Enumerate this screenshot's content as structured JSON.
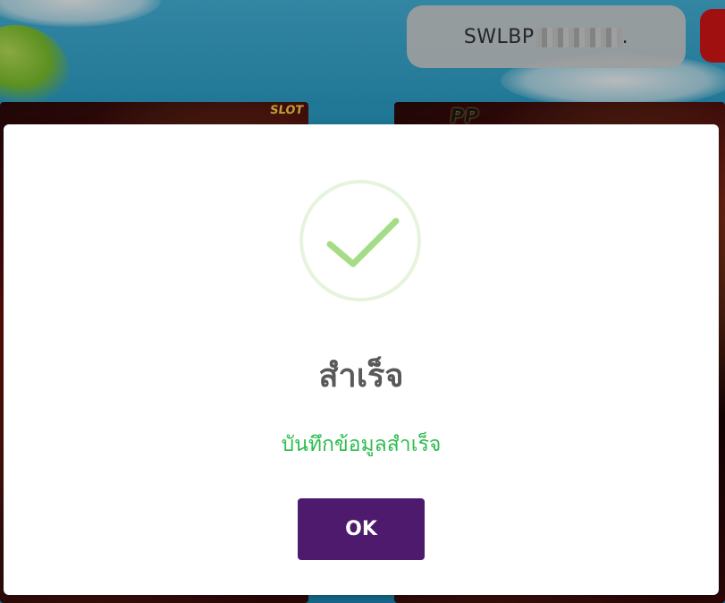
{
  "header": {
    "username_visible": "SWLBP",
    "username_suffix": "."
  },
  "background": {
    "thumbnails": [
      {
        "label": "SLOT"
      },
      {
        "label": "PP"
      }
    ]
  },
  "modal": {
    "icon": "success-check-icon",
    "title": "สำเร็จ",
    "message": "บันทึกข้อมูลสำเร็จ",
    "ok_label": "OK"
  },
  "colors": {
    "accent": "#4d1a6e",
    "success_text": "#2ebc4f",
    "check": "#a5dc86",
    "check_ring": "#e6f4dc",
    "title": "#595959"
  }
}
